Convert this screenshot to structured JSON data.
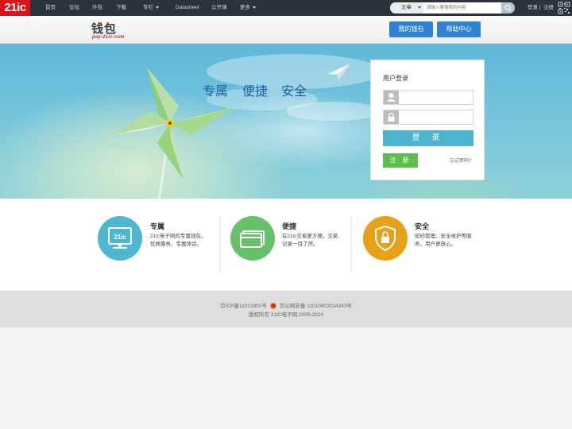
{
  "topbar": {
    "logo": "21ic",
    "nav": [
      {
        "label": "首页"
      },
      {
        "label": "论坛"
      },
      {
        "label": "外包"
      },
      {
        "label": "下载"
      },
      {
        "label": "专栏"
      },
      {
        "label": "Datasheet"
      },
      {
        "label": "公开课"
      },
      {
        "label": "更多"
      }
    ],
    "search": {
      "type": "文章",
      "placeholder": "请输入要搜索的内容"
    },
    "login": "登录",
    "separator": "|",
    "register": "注册"
  },
  "header": {
    "brand_main": "钱包",
    "brand_sub": "pay-21ic-com",
    "my_wallet": "我的钱包",
    "help_center": "帮助中心"
  },
  "banner": {
    "slogans": [
      "专属",
      "便捷",
      "安全"
    ]
  },
  "login": {
    "title": "用户登录",
    "username_placeholder": "",
    "password_placeholder": "",
    "login_button": "登 录",
    "register_button": "注 册",
    "forgot": "忘记密码?"
  },
  "features": [
    {
      "title": "专属",
      "desc": "21ic电子网的专属钱包，优质服务、专属体验。",
      "color": "#4fb6d1",
      "icon": "monitor-icon",
      "icon_text": "21ic"
    },
    {
      "title": "便捷",
      "desc": "在21ic交易更方便，交易记录一目了然。",
      "color": "#66c16a",
      "icon": "cards-icon"
    },
    {
      "title": "安全",
      "desc": "密码管理、安全维护等服务，用户更放心。",
      "color": "#e6a118",
      "icon": "lock-shield-icon"
    }
  ],
  "footer": {
    "icp": "京ICP备11013301号",
    "police": "京公网安备 11010802024343号",
    "copyright": "版权所有 21IC电子网 2000-2024"
  }
}
